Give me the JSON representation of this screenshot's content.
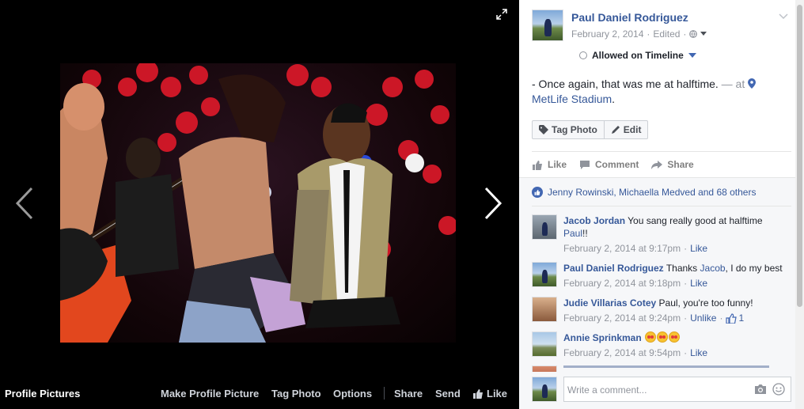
{
  "viewer": {
    "album_name": "Profile Pictures",
    "actions": {
      "make_profile": "Make Profile Picture",
      "tag_photo": "Tag Photo",
      "options": "Options",
      "share": "Share",
      "send": "Send",
      "like": "Like"
    }
  },
  "post": {
    "owner": "Paul Daniel Rodriguez",
    "date": "February 2, 2014",
    "edited": "Edited",
    "dot": "·",
    "timeline_label": "Allowed on Timeline",
    "caption": "- Once again, that was me at halftime.",
    "at_text": "— at",
    "place": "MetLife Stadium",
    "place_end": ".",
    "buttons": {
      "tag_photo": "Tag Photo",
      "edit": "Edit"
    },
    "actions": {
      "like": "Like",
      "comment": "Comment",
      "share": "Share"
    },
    "likes_summary": "Jenny Rowinski, Michaella Medved and 68 others"
  },
  "comments": [
    {
      "name": "Jacob Jordan",
      "text_before": "You sang really good at halftime",
      "tag": "Paul",
      "text_after": "!!",
      "time": "February 2, 2014 at 9:17pm",
      "sep": "·",
      "action": "Like"
    },
    {
      "name": "Paul Daniel Rodriguez",
      "text_before": "Thanks",
      "tag": "Jacob",
      "text_after": ", I do my best",
      "time": "February 2, 2014 at 9:18pm",
      "sep": "·",
      "action": "Like"
    },
    {
      "name": "Judie Villarias Cotey",
      "text_before": "Paul, you're too funny!",
      "time": "February 2, 2014 at 9:24pm",
      "sep": "·",
      "action": "Unlike",
      "likes": "1"
    },
    {
      "name": "Annie Sprinkman",
      "time": "February 2, 2014 at 9:54pm",
      "sep": "·",
      "action": "Like"
    }
  ],
  "comment_box": {
    "placeholder": "Write a comment..."
  },
  "colors": {
    "link": "#365899",
    "meta": "#90949c",
    "accent": "#4267b2"
  }
}
